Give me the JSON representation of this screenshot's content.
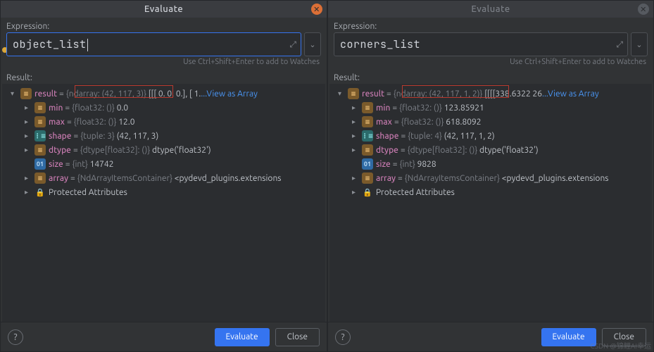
{
  "panes": [
    {
      "id": "left",
      "title": "Evaluate",
      "active": true,
      "expression_label": "Expression:",
      "expression_value": "object_list",
      "has_caret": true,
      "hint": "Use Ctrl+Shift+Enter to add to Watches",
      "result_label": "Result:",
      "redbox_label": "{ndarray: (42, 117, 3)}",
      "result_root": {
        "name": "result",
        "type": "{ndarray: (42, 117, 3)}",
        "preview": "[[[ 0.  0.  0.],  [ 1. ",
        "view_as_array": "...View as Array"
      },
      "children": [
        {
          "arrow": "right",
          "ico": "field",
          "name": "min",
          "type": "{float32: ()}",
          "val": "0.0"
        },
        {
          "arrow": "right",
          "ico": "field",
          "name": "max",
          "type": "{float32: ()}",
          "val": "12.0"
        },
        {
          "arrow": "right",
          "ico": "list",
          "name": "shape",
          "type": "{tuple: 3}",
          "val": "(42, 117, 3)"
        },
        {
          "arrow": "right",
          "ico": "field",
          "name": "dtype",
          "type": "{dtype[float32]: ()}",
          "val": "dtype('float32')"
        },
        {
          "arrow": "none",
          "ico": "int",
          "name": "size",
          "type": "{int}",
          "val": "14742"
        },
        {
          "arrow": "right",
          "ico": "field",
          "name": "array",
          "type": "{NdArrayItemsContainer}",
          "val": "<pydevd_plugins.extensions"
        },
        {
          "arrow": "right",
          "ico": "lock",
          "plain": "Protected Attributes"
        }
      ],
      "buttons": {
        "evaluate": "Evaluate",
        "close": "Close"
      }
    },
    {
      "id": "right",
      "title": "Evaluate",
      "active": false,
      "expression_label": "Expression:",
      "expression_value": "corners_list",
      "has_caret": false,
      "hint": "Use Ctrl+Shift+Enter to add to Watches",
      "result_label": "Result:",
      "redbox_label": "{ndarray: (42, 117, 1, 2)}",
      "result_root": {
        "name": "result",
        "type": "{ndarray: (42, 117, 1, 2)}",
        "preview": "[[[[338.6322  26",
        "view_as_array": "...View as Array"
      },
      "children": [
        {
          "arrow": "right",
          "ico": "field",
          "name": "min",
          "type": "{float32: ()}",
          "val": "123.85921"
        },
        {
          "arrow": "right",
          "ico": "field",
          "name": "max",
          "type": "{float32: ()}",
          "val": "618.8092"
        },
        {
          "arrow": "right",
          "ico": "list",
          "name": "shape",
          "type": "{tuple: 4}",
          "val": "(42, 117, 1, 2)"
        },
        {
          "arrow": "right",
          "ico": "field",
          "name": "dtype",
          "type": "{dtype[float32]: ()}",
          "val": "dtype('float32')"
        },
        {
          "arrow": "none",
          "ico": "int",
          "name": "size",
          "type": "{int}",
          "val": "9828"
        },
        {
          "arrow": "right",
          "ico": "field",
          "name": "array",
          "type": "{NdArrayItemsContainer}",
          "val": "<pydevd_plugins.extensions"
        },
        {
          "arrow": "right",
          "ico": "lock",
          "plain": "Protected Attributes"
        }
      ],
      "buttons": {
        "evaluate": "Evaluate",
        "close": "Close"
      }
    }
  ],
  "csdn": "CSDN @锦鲤AI幸运"
}
